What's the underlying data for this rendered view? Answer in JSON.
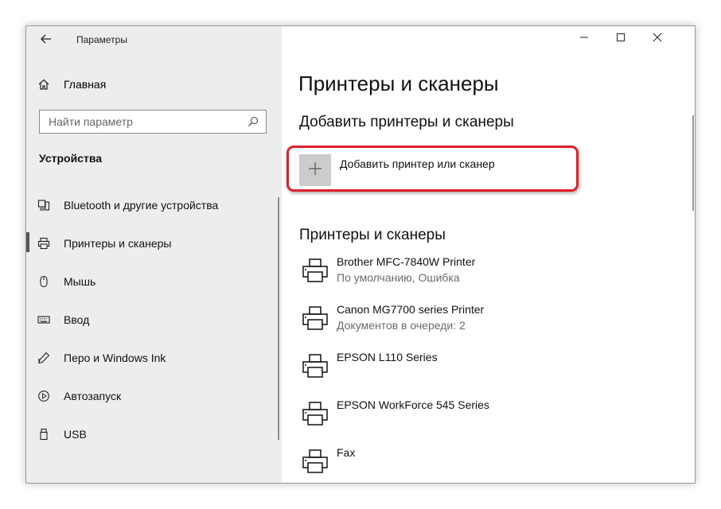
{
  "window": {
    "app_title": "Параметры"
  },
  "sidebar": {
    "home_label": "Главная",
    "search_placeholder": "Найти параметр",
    "section_title": "Устройства",
    "items": [
      {
        "label": "Bluetooth и другие устройства",
        "icon": "bluetooth-devices-icon"
      },
      {
        "label": "Принтеры и сканеры",
        "icon": "printer-icon",
        "active": true
      },
      {
        "label": "Мышь",
        "icon": "mouse-icon"
      },
      {
        "label": "Ввод",
        "icon": "keyboard-icon"
      },
      {
        "label": "Перо и Windows Ink",
        "icon": "pen-icon"
      },
      {
        "label": "Автозапуск",
        "icon": "autoplay-icon"
      },
      {
        "label": "USB",
        "icon": "usb-icon"
      }
    ]
  },
  "main": {
    "page_title": "Принтеры и сканеры",
    "add_section_title": "Добавить принтеры и сканеры",
    "add_button_label": "Добавить принтер или сканер",
    "list_title": "Принтеры и сканеры",
    "printers": [
      {
        "name": "Brother MFC-7840W Printer",
        "status": "По умолчанию, Ошибка"
      },
      {
        "name": "Canon MG7700 series Printer",
        "status": "Документов в очереди: 2"
      },
      {
        "name": "EPSON L110 Series",
        "status": ""
      },
      {
        "name": "EPSON WorkForce 545 Series",
        "status": ""
      },
      {
        "name": "Fax",
        "status": ""
      }
    ]
  },
  "colors": {
    "sidebar_bg": "#ededed",
    "highlight": "#e0202a",
    "plus_box": "#cccccc",
    "status_text": "#6b6b6b"
  }
}
